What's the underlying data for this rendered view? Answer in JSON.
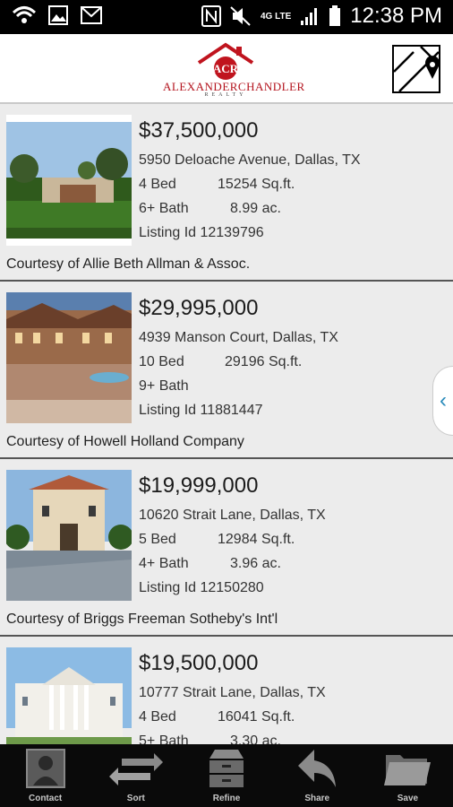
{
  "status": {
    "time": "12:38 PM",
    "network": "4G LTE"
  },
  "header": {
    "logo_letters": "ACR",
    "brand": "ALEXANDERCHANDLER",
    "brand_sub": "REALTY"
  },
  "listings": [
    {
      "price": "$37,500,000",
      "address": "5950 Deloache Avenue,  Dallas, TX",
      "beds": "4 Bed",
      "sqft": "15254 Sq.ft.",
      "baths": "6+ Bath",
      "acres": "8.99 ac.",
      "listing_id": "Listing Id 12139796",
      "courtesy": "Courtesy of Allie Beth Allman & Assoc."
    },
    {
      "price": "$29,995,000",
      "address": "4939 Manson Court, Dallas, TX",
      "beds": "10 Bed",
      "sqft": "29196 Sq.ft.",
      "baths": "9+ Bath",
      "acres": "",
      "listing_id": "Listing Id 11881447",
      "courtesy": "Courtesy of Howell Holland Company"
    },
    {
      "price": "$19,999,000",
      "address": "10620 Strait Lane, Dallas, TX",
      "beds": "5 Bed",
      "sqft": "12984 Sq.ft.",
      "baths": "4+ Bath",
      "acres": "3.96 ac.",
      "listing_id": "Listing Id 12150280",
      "courtesy": "Courtesy of Briggs Freeman Sotheby's Int'l"
    },
    {
      "price": "$19,500,000",
      "address": "10777 Strait Lane, Dallas, TX",
      "beds": "4 Bed",
      "sqft": "16041 Sq.ft.",
      "baths": "5+ Bath",
      "acres": "3.30 ac.",
      "listing_id": "",
      "courtesy": ""
    }
  ],
  "bottom_nav": [
    {
      "label": "Contact",
      "icon": "contact-icon"
    },
    {
      "label": "Sort",
      "icon": "sort-arrows-icon"
    },
    {
      "label": "Refine",
      "icon": "refine-drawer-icon"
    },
    {
      "label": "Share",
      "icon": "share-arrow-icon"
    },
    {
      "label": "Save",
      "icon": "folder-icon"
    }
  ]
}
